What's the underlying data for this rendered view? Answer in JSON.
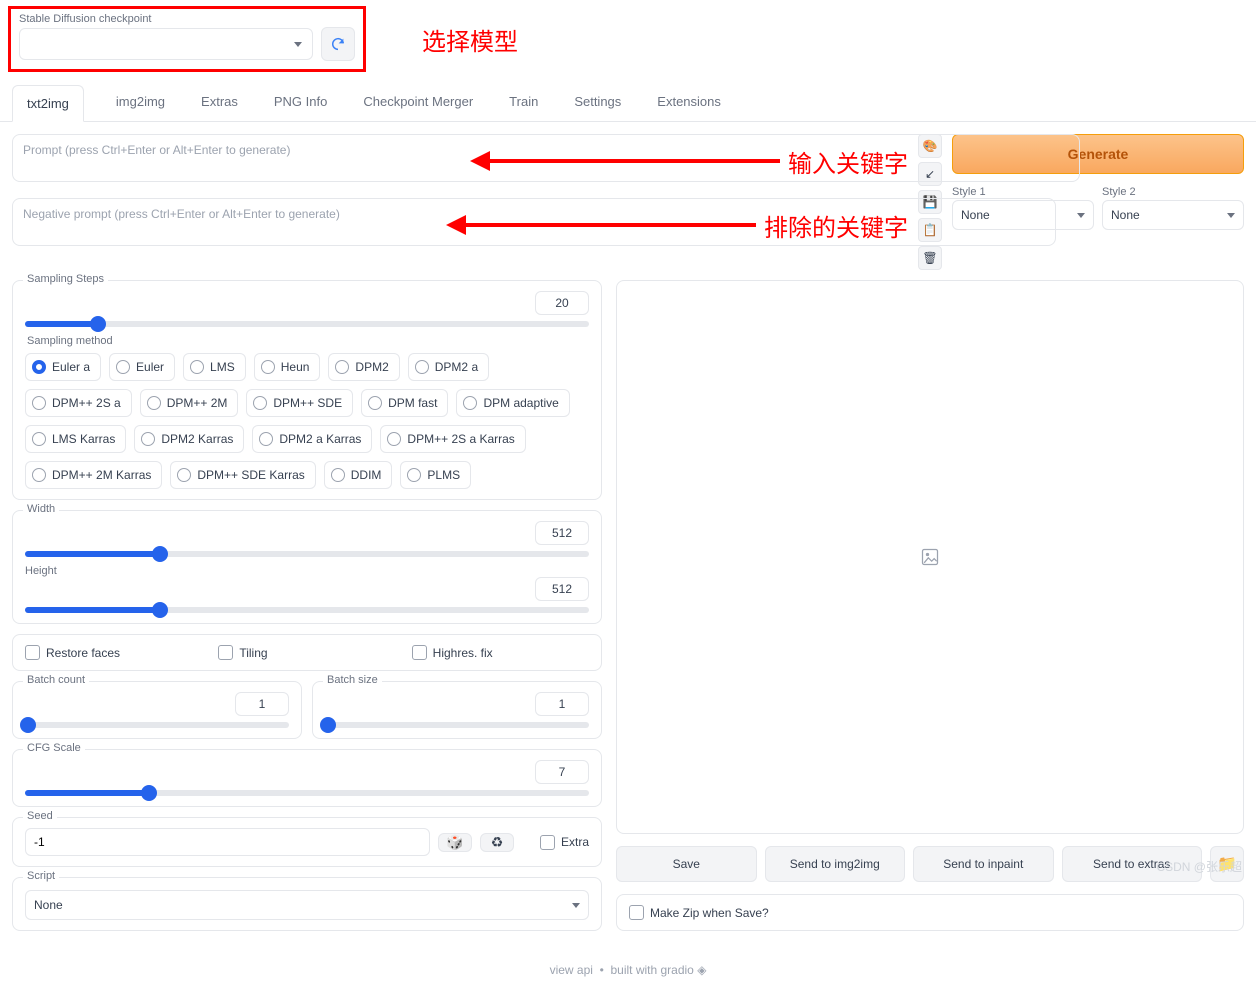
{
  "annotations": {
    "select_model": "选择模型",
    "enter_keywords": "输入关键字",
    "exclude_keywords": "排除的关键字"
  },
  "checkpoint": {
    "label": "Stable Diffusion checkpoint",
    "value": ""
  },
  "tabs": [
    "txt2img",
    "img2img",
    "Extras",
    "PNG Info",
    "Checkpoint Merger",
    "Train",
    "Settings",
    "Extensions"
  ],
  "active_tab": "txt2img",
  "prompt": {
    "placeholder": "Prompt (press Ctrl+Enter or Alt+Enter to generate)"
  },
  "neg_prompt": {
    "placeholder": "Negative prompt (press Ctrl+Enter or Alt+Enter to generate)"
  },
  "icon_buttons": {
    "interrogate": "🎨",
    "clear": "↙",
    "save_style": "💾",
    "paste": "📋",
    "delete": "🗑"
  },
  "generate_label": "Generate",
  "style1": {
    "label": "Style 1",
    "value": "None"
  },
  "style2": {
    "label": "Style 2",
    "value": "None"
  },
  "sampling_steps": {
    "label": "Sampling Steps",
    "value": 20,
    "max": 150
  },
  "sampling_method": {
    "label": "Sampling method",
    "selected": "Euler a",
    "options": [
      "Euler a",
      "Euler",
      "LMS",
      "Heun",
      "DPM2",
      "DPM2 a",
      "DPM++ 2S a",
      "DPM++ 2M",
      "DPM++ SDE",
      "DPM fast",
      "DPM adaptive",
      "LMS Karras",
      "DPM2 Karras",
      "DPM2 a Karras",
      "DPM++ 2S a Karras",
      "DPM++ 2M Karras",
      "DPM++ SDE Karras",
      "DDIM",
      "PLMS"
    ]
  },
  "width": {
    "label": "Width",
    "value": 512,
    "max": 2048
  },
  "height": {
    "label": "Height",
    "value": 512,
    "max": 2048
  },
  "checkboxes": {
    "restore_faces": "Restore faces",
    "tiling": "Tiling",
    "highres_fix": "Highres. fix"
  },
  "batch_count": {
    "label": "Batch count",
    "value": 1,
    "max": 100
  },
  "batch_size": {
    "label": "Batch size",
    "value": 1,
    "max": 8
  },
  "cfg": {
    "label": "CFG Scale",
    "value": 7,
    "max": 30
  },
  "seed": {
    "label": "Seed",
    "value": "-1",
    "extra_label": "Extra"
  },
  "script": {
    "label": "Script",
    "value": "None"
  },
  "actions": {
    "save": "Save",
    "img2img": "Send to img2img",
    "inpaint": "Send to inpaint",
    "extras": "Send to extras"
  },
  "zip_label": "Make Zip when Save?",
  "footer": {
    "api": "view api",
    "built": "built with gradio"
  },
  "watermark": "CSDN @张乐超"
}
